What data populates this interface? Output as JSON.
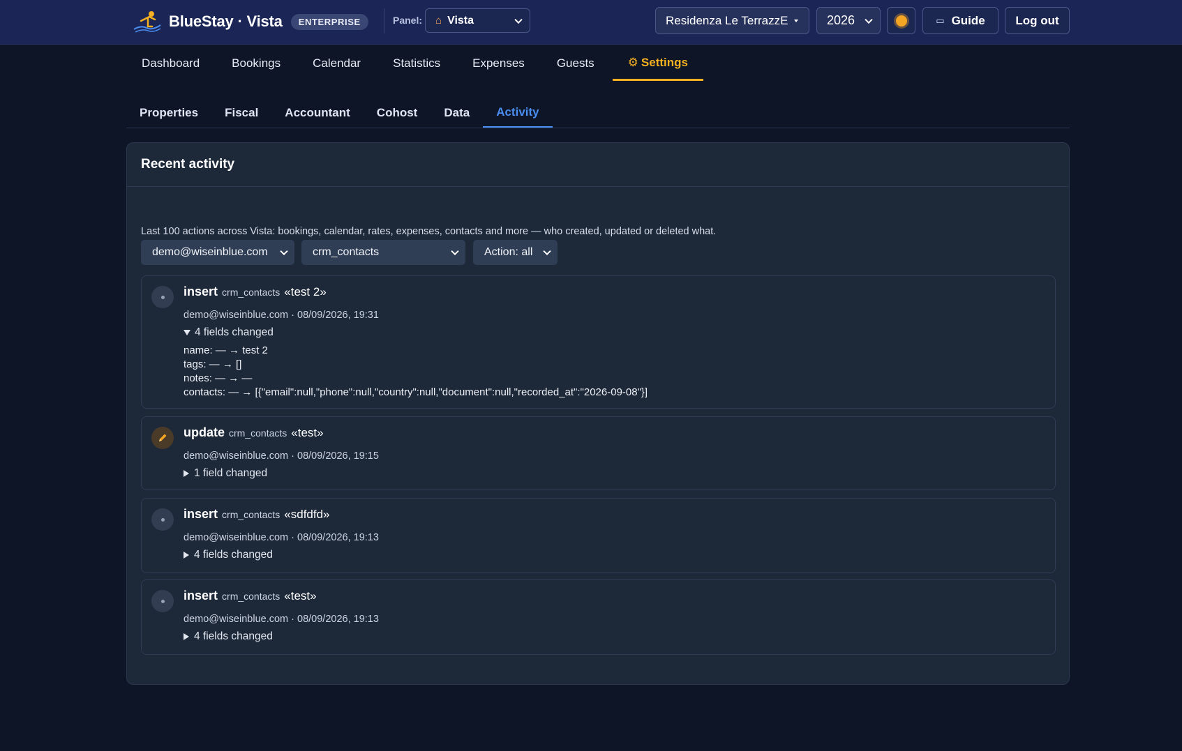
{
  "header": {
    "brand": "BlueStay · Vista",
    "badge": "ENTERPRISE",
    "panel_label": "Panel:",
    "panel_value": "Vista",
    "property": "Residenza Le TerrazzE",
    "year": "2026",
    "guide_label": "Guide",
    "logout_label": "Log out"
  },
  "nav": {
    "items": [
      "Dashboard",
      "Bookings",
      "Calendar",
      "Statistics",
      "Expenses",
      "Guests"
    ],
    "active": "Settings"
  },
  "subtabs": {
    "items": [
      "Properties",
      "Fiscal",
      "Accountant",
      "Cohost",
      "Data"
    ],
    "active": "Activity"
  },
  "card": {
    "title": "Recent activity",
    "description": "Last 100 actions across Vista: bookings, calendar, rates, expenses, contacts and more — who created, updated or deleted what."
  },
  "filters": {
    "user": "demo@wiseinblue.com",
    "table": "crm_contacts",
    "action": "Action: all"
  },
  "entries": [
    {
      "action": "insert",
      "table": "crm_contacts",
      "record": "«test 2»",
      "meta": "demo@wiseinblue.com · 08/09/2026, 19:31",
      "summary": "4 fields changed",
      "fields": [
        "name: — → test 2",
        "tags: — → []",
        "notes: — → —",
        "contacts: — → [{\"email\":null,\"phone\":null,\"country\":null,\"document\":null,\"recorded_at\":\"2026-09-08\"}]"
      ]
    },
    {
      "action": "update",
      "table": "crm_contacts",
      "record": "«test»",
      "meta": "demo@wiseinblue.com · 08/09/2026, 19:15",
      "summary": "1 field changed"
    },
    {
      "action": "insert",
      "table": "crm_contacts",
      "record": "«sdfdfd»",
      "meta": "demo@wiseinblue.com · 08/09/2026, 19:13",
      "summary": "4 fields changed"
    },
    {
      "action": "insert",
      "table": "crm_contacts",
      "record": "«test»",
      "meta": "demo@wiseinblue.com · 08/09/2026, 19:13",
      "summary": "4 fields changed"
    }
  ],
  "colors": {
    "topbar": "#1b2656",
    "background": "#0d1527",
    "accent_nav": "#f5b021",
    "accent_tab": "#4b8ef1"
  },
  "icons": {
    "logo": "bluestay-logo-icon",
    "house": "house-icon",
    "theme": "sun-icon",
    "guide": "book-icon",
    "settings": "gear-icon",
    "insert": "dot-icon",
    "update": "pencil-icon"
  }
}
